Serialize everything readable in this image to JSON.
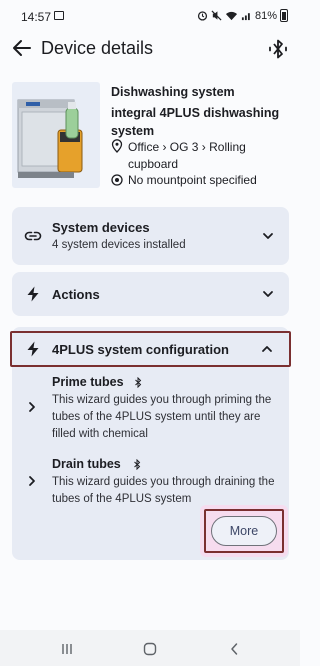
{
  "status_bar": {
    "time": "14:57",
    "battery": "81%",
    "icons": [
      "image-icon",
      "alarm-icon",
      "mute-icon",
      "wifi-icon",
      "signal-icon",
      "battery-icon"
    ]
  },
  "app_bar": {
    "title": "Device details",
    "back_icon": "arrow-back-icon",
    "action_icon": "bluetooth-icon"
  },
  "device": {
    "name": "Dishwashing system",
    "model": "integral 4PLUS dishwashing system",
    "location": "Office › OG 3 › Rolling cupboard",
    "mountpoint": "No mountpoint specified"
  },
  "sections": {
    "system_devices": {
      "title": "System devices",
      "subtitle": "4 system devices installed",
      "icon": "link-icon"
    },
    "actions": {
      "title": "Actions",
      "icon": "bolt-icon"
    },
    "configuration": {
      "title": "4PLUS system configuration",
      "icon": "bolt-icon",
      "items": [
        {
          "title": "Prime tubes",
          "description": "This wizard guides you through priming the tubes of the 4PLUS system until they are filled with chemical"
        },
        {
          "title": "Drain tubes",
          "description": "This wizard guides you through draining the tubes of the 4PLUS system"
        }
      ],
      "more_label": "More"
    }
  },
  "colors": {
    "card_bg": "#e7ebf4",
    "highlight_border": "#7a2f30",
    "highlight_glow": "#f6dcef",
    "button_text": "#3d4767"
  }
}
